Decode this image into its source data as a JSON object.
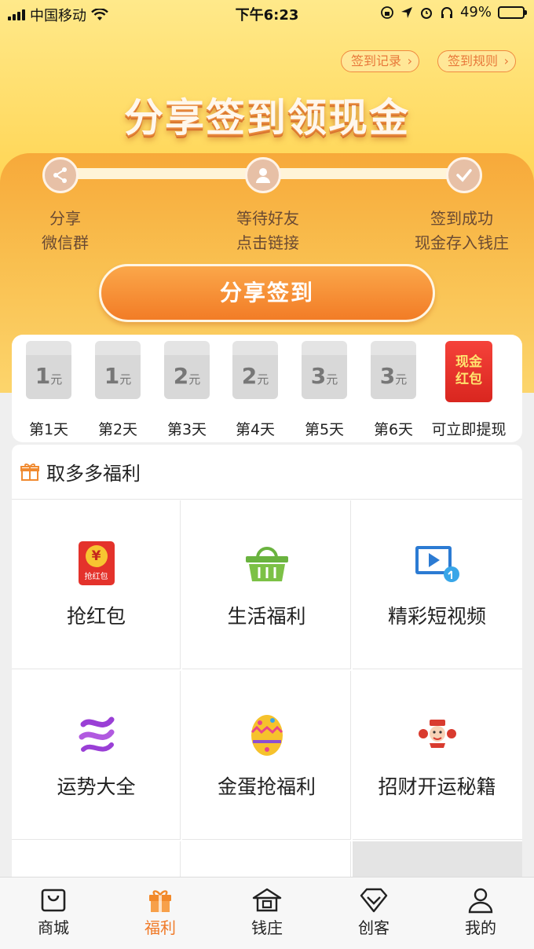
{
  "status_bar": {
    "carrier": "中国移动",
    "time": "下午6:23",
    "battery": "49%",
    "battery_level": 0.49
  },
  "header": {
    "record_label": "签到记录",
    "rules_label": "签到规则",
    "title": "分享签到领现金"
  },
  "steps": [
    {
      "line1": "分享",
      "line2": "微信群",
      "icon": "share-icon"
    },
    {
      "line1": "等待好友",
      "line2": "点击链接",
      "icon": "user-icon"
    },
    {
      "line1": "签到成功",
      "line2": "现金存入钱庄",
      "icon": "check-icon"
    }
  ],
  "cta_label": "分享签到",
  "days": [
    {
      "amount": "1",
      "unit": "元",
      "label": "第1天"
    },
    {
      "amount": "1",
      "unit": "元",
      "label": "第2天"
    },
    {
      "amount": "2",
      "unit": "元",
      "label": "第3天"
    },
    {
      "amount": "2",
      "unit": "元",
      "label": "第4天"
    },
    {
      "amount": "3",
      "unit": "元",
      "label": "第5天"
    },
    {
      "amount": "3",
      "unit": "元",
      "label": "第6天"
    }
  ],
  "final_day": {
    "line1": "现金",
    "line2": "红包",
    "label": "可立即提现"
  },
  "welfare": {
    "title": "取多多福利",
    "items": [
      {
        "label": "抢红包",
        "icon": "red-envelope-icon",
        "badge": "抢红包"
      },
      {
        "label": "生活福利",
        "icon": "basket-icon"
      },
      {
        "label": "精彩短视频",
        "icon": "video-icon"
      },
      {
        "label": "运势大全",
        "icon": "fortune-wave-icon"
      },
      {
        "label": "金蛋抢福利",
        "icon": "golden-egg-icon"
      },
      {
        "label": "招财开运秘籍",
        "icon": "fortune-god-icon"
      }
    ]
  },
  "tabs": [
    {
      "label": "商城",
      "icon": "shopping-bag-icon"
    },
    {
      "label": "福利",
      "icon": "gift-icon",
      "active": true
    },
    {
      "label": "钱庄",
      "icon": "bank-icon"
    },
    {
      "label": "创客",
      "icon": "diamond-icon"
    },
    {
      "label": "我的",
      "icon": "profile-icon"
    }
  ],
  "colors": {
    "accent": "#f07a28",
    "hero_yellow": "#ffd85c",
    "red_pack": "#e0302a"
  }
}
